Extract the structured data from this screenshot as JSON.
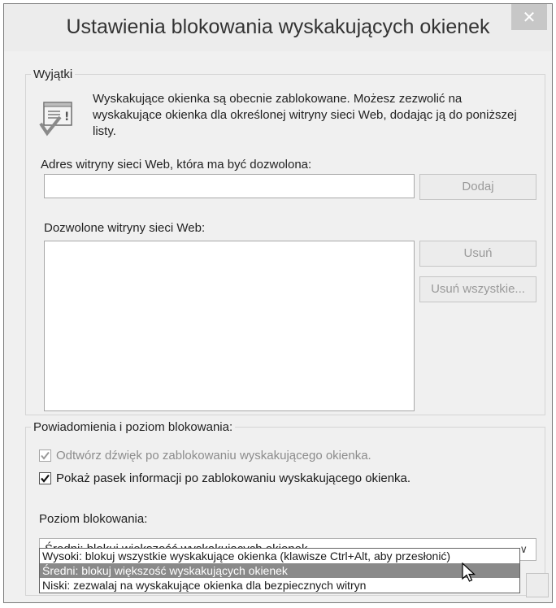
{
  "window": {
    "title": "Ustawienia blokowania wyskakujących okienek",
    "close_symbol": "✕"
  },
  "exceptions": {
    "legend": "Wyjątki",
    "icon": "popup-blocked-info-icon",
    "info_text": "Wyskakujące okienka są obecnie zablokowane. Możesz zezwolić na wyskakujące okienka dla określonej witryny sieci Web, dodając ją do poniższej listy.",
    "address_label": "Adres witryny sieci Web, która ma być dozwolona:",
    "address_value": "",
    "add_button": "Dodaj",
    "allowed_label": "Dozwolone witryny sieci Web:",
    "allowed_sites": [],
    "remove_button": "Usuń",
    "remove_all_button": "Usuń wszystkie..."
  },
  "notifications": {
    "legend": "Powiadomienia i poziom blokowania:",
    "play_sound": {
      "label": "Odtwórz dźwięk po zablokowaniu wyskakującego okienka.",
      "checked": true,
      "enabled": false
    },
    "show_bar": {
      "label": "Pokaż pasek informacji po zablokowaniu wyskakującego okienka.",
      "checked": true,
      "enabled": true
    },
    "level_label": "Poziom blokowania:",
    "level_selected": "Średni: blokuj większość wyskakujących okienek",
    "level_options": [
      "Wysoki: blokuj wszystkie wyskakujące okienka (klawisze Ctrl+Alt, aby przesłonić)",
      "Średni: blokuj większość wyskakujących okienek",
      "Niski: zezwalaj na wyskakujące okienka dla bezpiecznych witryn"
    ],
    "highlighted_option_index": 1
  }
}
